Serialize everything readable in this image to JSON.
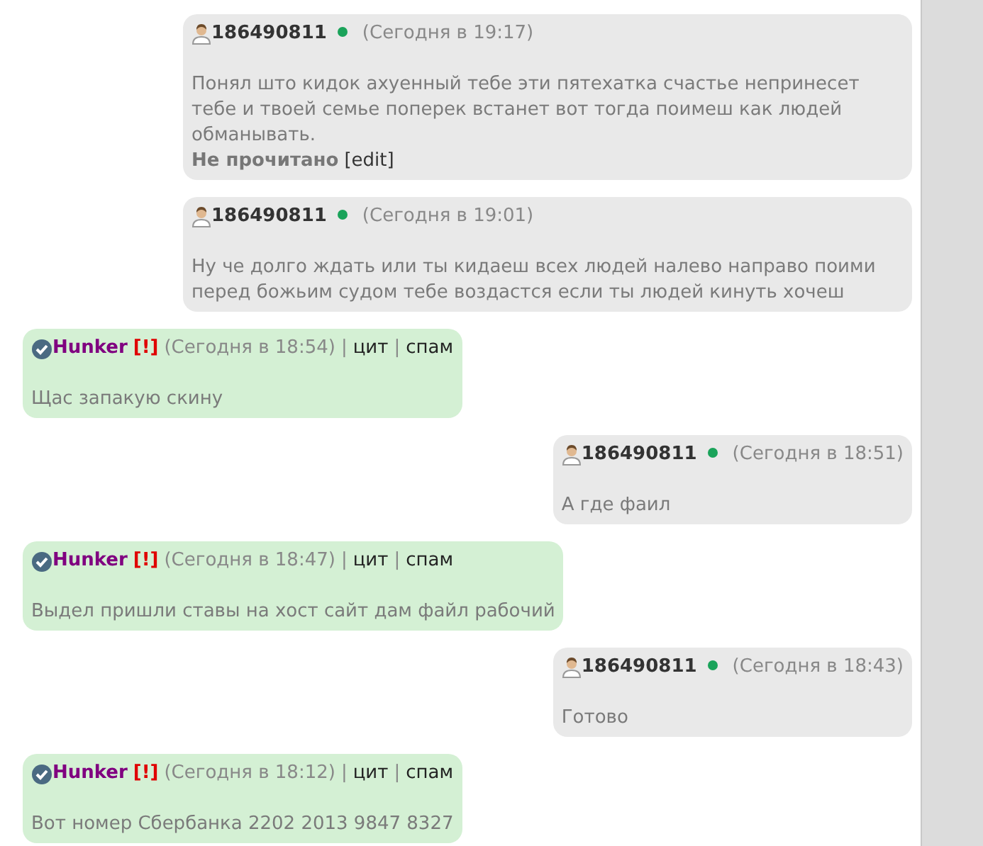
{
  "messages": [
    {
      "kind": "own",
      "author": "186490811",
      "online": true,
      "time": "(Сегодня в 19:17)",
      "text": "Понял што кидок ахуенный тебе эти пятехатка счастье непринесет тебе и твоей семье поперек встанет вот тогда поимеш как людей обманывать.",
      "status": "Не прочитано",
      "edit": "[edit]"
    },
    {
      "kind": "own",
      "author": "186490811",
      "online": true,
      "time": "(Сегодня в 19:01)",
      "text": "Ну че долго ждать или ты кидаеш всех людей налево направо поими перед божьим судом тебе воздастся если ты людей кинуть хочеш"
    },
    {
      "kind": "incoming",
      "author": "Hunker",
      "flag": "[!]",
      "time": "(Сегодня в 18:54)",
      "actions": [
        {
          "separator": "|",
          "label": "цит"
        },
        {
          "separator": "|",
          "label": "спам"
        }
      ],
      "text": "Щас запакую скину"
    },
    {
      "kind": "own",
      "author": "186490811",
      "online": true,
      "time": "(Сегодня в 18:51)",
      "text": "А где фаил"
    },
    {
      "kind": "incoming",
      "author": "Hunker",
      "flag": "[!]",
      "time": "(Сегодня в 18:47)",
      "actions": [
        {
          "separator": "|",
          "label": "цит"
        },
        {
          "separator": "|",
          "label": "спам"
        }
      ],
      "text": "Выдел пришли ставы на хост сайт дам файл рабочий"
    },
    {
      "kind": "own",
      "author": "186490811",
      "online": true,
      "time": "(Сегодня в 18:43)",
      "text": "Готово"
    },
    {
      "kind": "incoming",
      "author": "Hunker",
      "flag": "[!]",
      "time": "(Сегодня в 18:12)",
      "actions": [
        {
          "separator": "|",
          "label": "цит"
        },
        {
          "separator": "|",
          "label": "спам"
        }
      ],
      "text": "Вот номер Сбербанка 2202 2013 9847 8327"
    }
  ]
}
